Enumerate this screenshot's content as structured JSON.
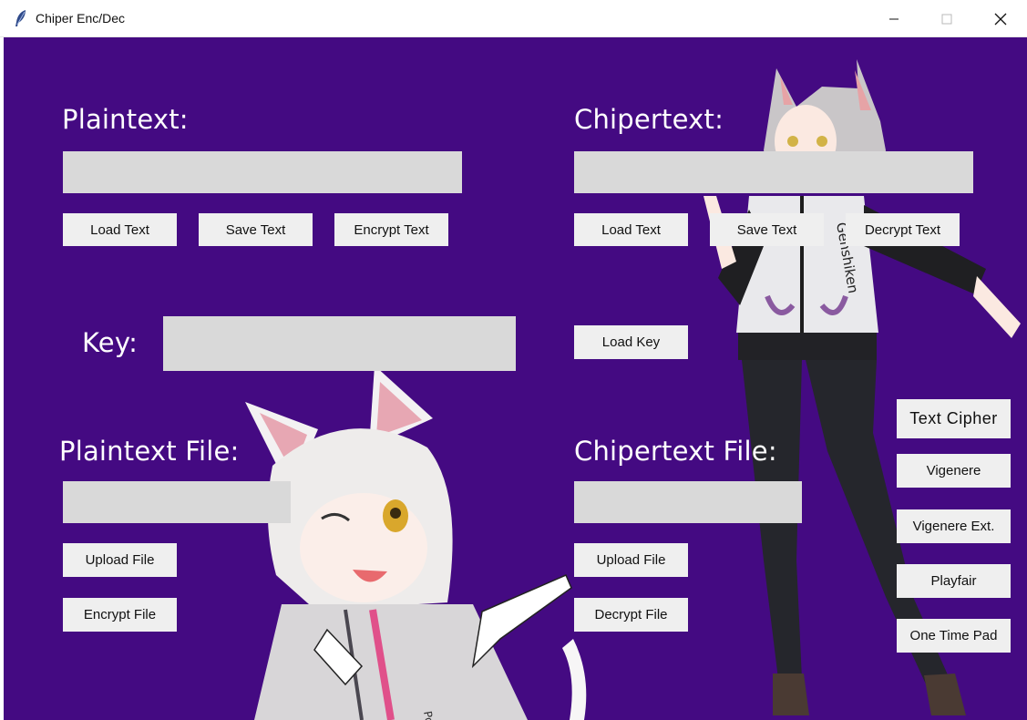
{
  "window": {
    "title": "Chiper Enc/Dec",
    "background": "#440a82"
  },
  "plaintext": {
    "label": "Plaintext:",
    "value": "",
    "buttons": {
      "load": "Load Text",
      "save": "Save Text",
      "encrypt": "Encrypt Text"
    }
  },
  "chipertext": {
    "label": "Chipertext:",
    "value": "",
    "buttons": {
      "load": "Load Text",
      "save": "Save Text",
      "decrypt": "Decrypt Text"
    }
  },
  "key": {
    "label": "Key:",
    "value": "",
    "load_button": "Load Key"
  },
  "plaintext_file": {
    "label": "Plaintext File:",
    "value": "",
    "buttons": {
      "upload": "Upload File",
      "encrypt": "Encrypt File"
    }
  },
  "chipertext_file": {
    "label": "Chipertext File:",
    "value": "",
    "buttons": {
      "upload": "Upload File",
      "decrypt": "Decrypt File"
    }
  },
  "cipher_menu": {
    "header": "Text Cipher",
    "items": [
      "Vigenere",
      "Vigenere Ext.",
      "Playfair",
      "One Time Pad"
    ]
  },
  "decor": {
    "hoodie_brand": "Genshiken",
    "hoodie_text_2": "Pop",
    "icons": [
      "feather-icon",
      "minimize-icon",
      "maximize-icon",
      "close-icon"
    ]
  }
}
